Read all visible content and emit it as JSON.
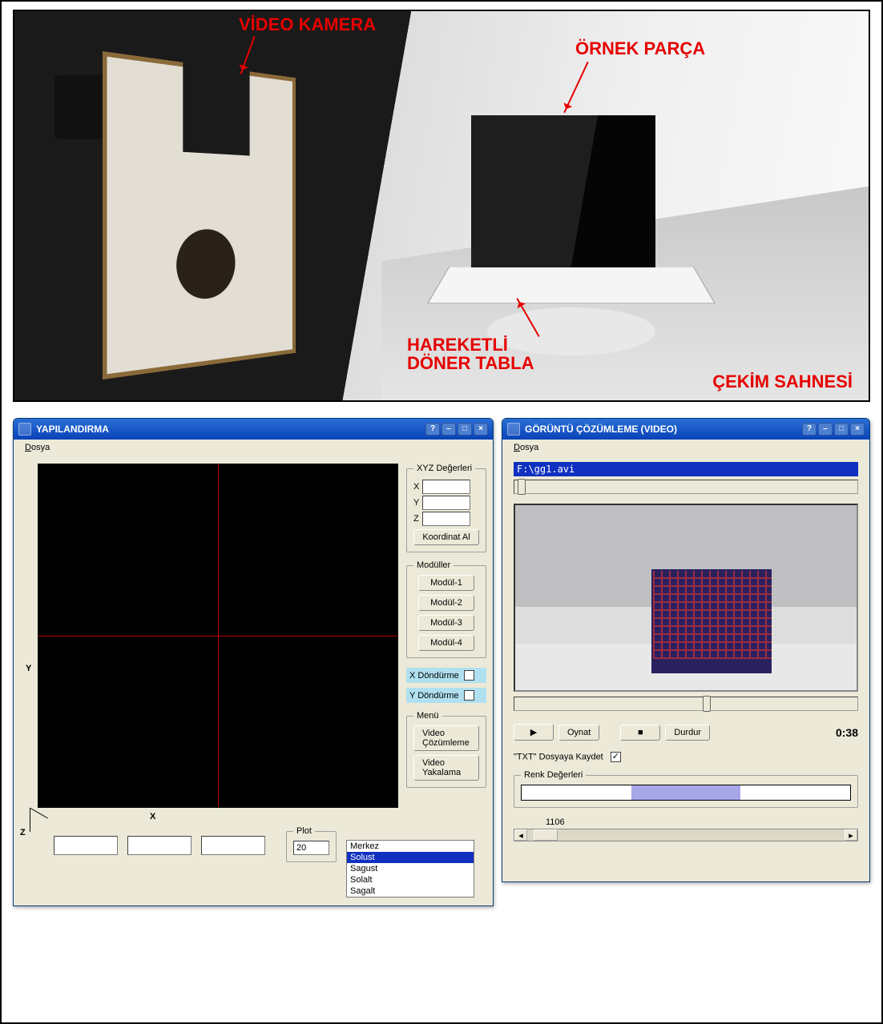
{
  "photo": {
    "label_camera": "VİDEO KAMERA",
    "label_sample": "ÖRNEK PARÇA",
    "label_turntable_1": "HAREKETLİ",
    "label_turntable_2": "DÖNER TABLA",
    "label_scene": "ÇEKİM SAHNESİ"
  },
  "win_left": {
    "title": "YAPILANDIRMA",
    "menu_file": "Dosya",
    "axes": {
      "y": "Y",
      "x": "X",
      "z": "Z"
    },
    "xyz_group": "XYZ Değerleri",
    "lbl_x": "X",
    "lbl_y": "Y",
    "lbl_z": "Z",
    "btn_coord": "Koordinat Al",
    "modules_group": "Modüller",
    "btn_mod1": "Modül-1",
    "btn_mod2": "Modül-2",
    "btn_mod3": "Modül-3",
    "btn_mod4": "Modül-4",
    "lbl_xrot": "X Döndürme",
    "lbl_yrot": "Y Döndürme",
    "menu_group": "Menü",
    "btn_video_analysis": "Video Çözümleme",
    "btn_video_capture": "Video Yakalama",
    "plot_group": "Plot",
    "plot_value": "20",
    "list": [
      "Merkez",
      "Solust",
      "Sagust",
      "Solalt",
      "Sagalt"
    ],
    "list_selected_index": 1
  },
  "win_right": {
    "title": "GÖRÜNTÜ ÇÖZÜMLEME (VIDEO)",
    "menu_file": "Dosya",
    "path": "F:\\gg1.avi",
    "play_icon": "▶",
    "stop_icon": "■",
    "btn_play": "Oynat",
    "btn_stop": "Durdur",
    "time": "0:38",
    "save_txt": "\"TXT\" Dosyaya Kaydet",
    "color_group": "Renk Değerleri",
    "counter": "1106"
  },
  "wbtn_glyphs": {
    "help": "?",
    "min": "–",
    "max": "□",
    "close": "×"
  }
}
